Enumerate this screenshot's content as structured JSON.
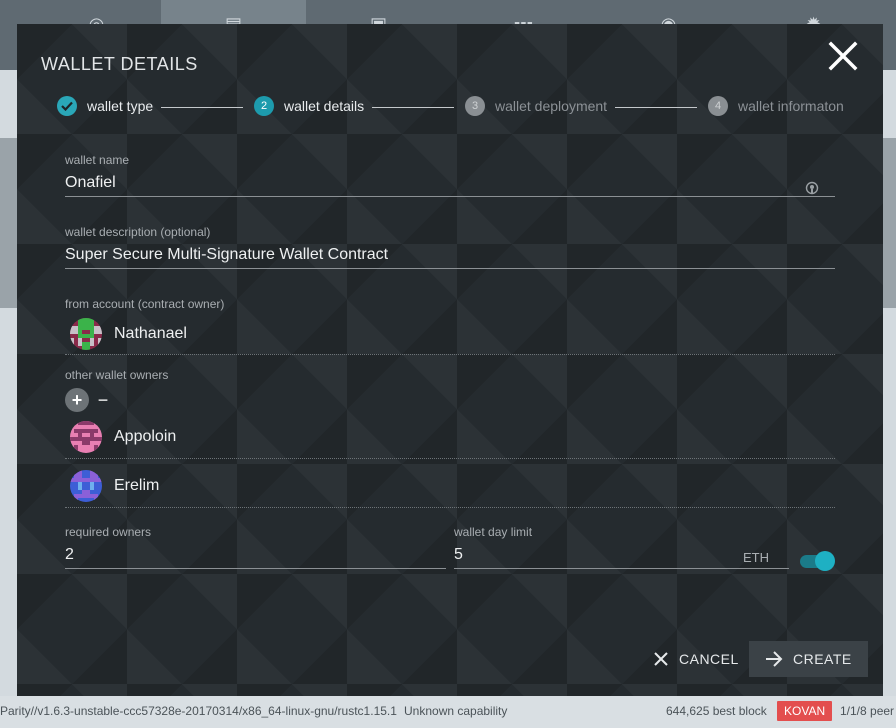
{
  "modal": {
    "title": "WALLET DETAILS"
  },
  "stepper": {
    "steps": [
      {
        "number": "1",
        "label": "wallet type",
        "state": "done"
      },
      {
        "number": "2",
        "label": "wallet details",
        "state": "active"
      },
      {
        "number": "3",
        "label": "wallet deployment",
        "state": "pending"
      },
      {
        "number": "4",
        "label": "wallet informaton",
        "state": "pending"
      }
    ]
  },
  "form": {
    "wallet_name": {
      "label": "wallet name",
      "value": "Onafiel"
    },
    "wallet_description": {
      "label": "wallet description (optional)",
      "value": "Super Secure Multi-Signature Wallet Contract"
    },
    "from_account": {
      "label": "from account (contract owner)",
      "value": "Nathanael"
    },
    "other_owners": {
      "label": "other wallet owners",
      "add_icon": "+",
      "remove_icon": "−",
      "owners": [
        "Appoloin",
        "Erelim"
      ]
    },
    "required_owners": {
      "label": "required owners",
      "value": "2"
    },
    "day_limit": {
      "label": "wallet day limit",
      "value": "5",
      "unit": "ETH",
      "enabled": true
    }
  },
  "actions": {
    "cancel_label": "CANCEL",
    "create_label": "CREATE"
  },
  "statusbar": {
    "version": "Parity//v1.6.3-unstable-ccc57328e-20170314/x86_64-linux-gnu/rustc1.15.1",
    "capability": "Unknown capability",
    "best_block": "644,625 best block",
    "network": "KOVAN",
    "peers": "1/1/8 peer"
  },
  "colors": {
    "accent": "#1eb0c3",
    "network_badge": "#e34e4e"
  },
  "icons": [
    "home-icon",
    "accounts-icon",
    "addresses-icon",
    "apps-icon",
    "signer-icon",
    "settings-icon",
    "close-icon",
    "check-icon",
    "qr-icon",
    "add-icon",
    "remove-icon",
    "cancel-x-icon",
    "arrow-right-icon"
  ]
}
